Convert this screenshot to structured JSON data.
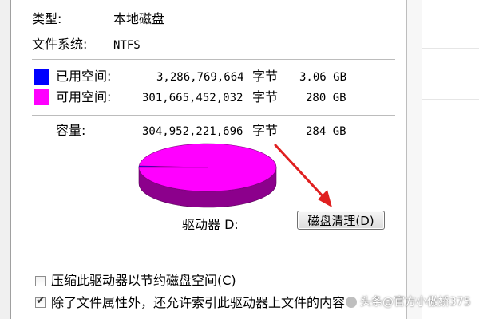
{
  "properties": {
    "type": {
      "label": "类型:",
      "value": "本地磁盘"
    },
    "filesystem": {
      "label": "文件系统:",
      "value": "NTFS"
    },
    "used": {
      "label": "已用空间:",
      "bytes": "3,286,769,664",
      "unit": "字节",
      "size": "3.06 GB",
      "color": "#0000ff"
    },
    "free": {
      "label": "可用空间:",
      "bytes": "301,665,452,032",
      "unit": "字节",
      "size": "280 GB",
      "color": "#ff00ff"
    },
    "capacity": {
      "label": "容量:",
      "bytes": "304,952,221,696",
      "unit": "字节",
      "size": "284 GB"
    },
    "drive_label": "驱动器 D:"
  },
  "chart_data": {
    "type": "pie",
    "categories": [
      "已用空间",
      "可用空间"
    ],
    "values": [
      3286769664,
      301665452032
    ],
    "colors": [
      "#0000ff",
      "#ff00ff"
    ]
  },
  "buttons": {
    "disk_cleanup_text": "磁盘清理",
    "disk_cleanup_mnemonic": "D",
    "disk_cleanup_close": ")"
  },
  "options": {
    "compress": {
      "label": "压缩此驱动器以节约磁盘空间(C)",
      "checked": false
    },
    "index": {
      "label": "除了文件属性外，还允许索引此驱动器上文件的内容",
      "checked": true
    }
  },
  "watermark": {
    "text": "头条@官方小傲娇375"
  }
}
